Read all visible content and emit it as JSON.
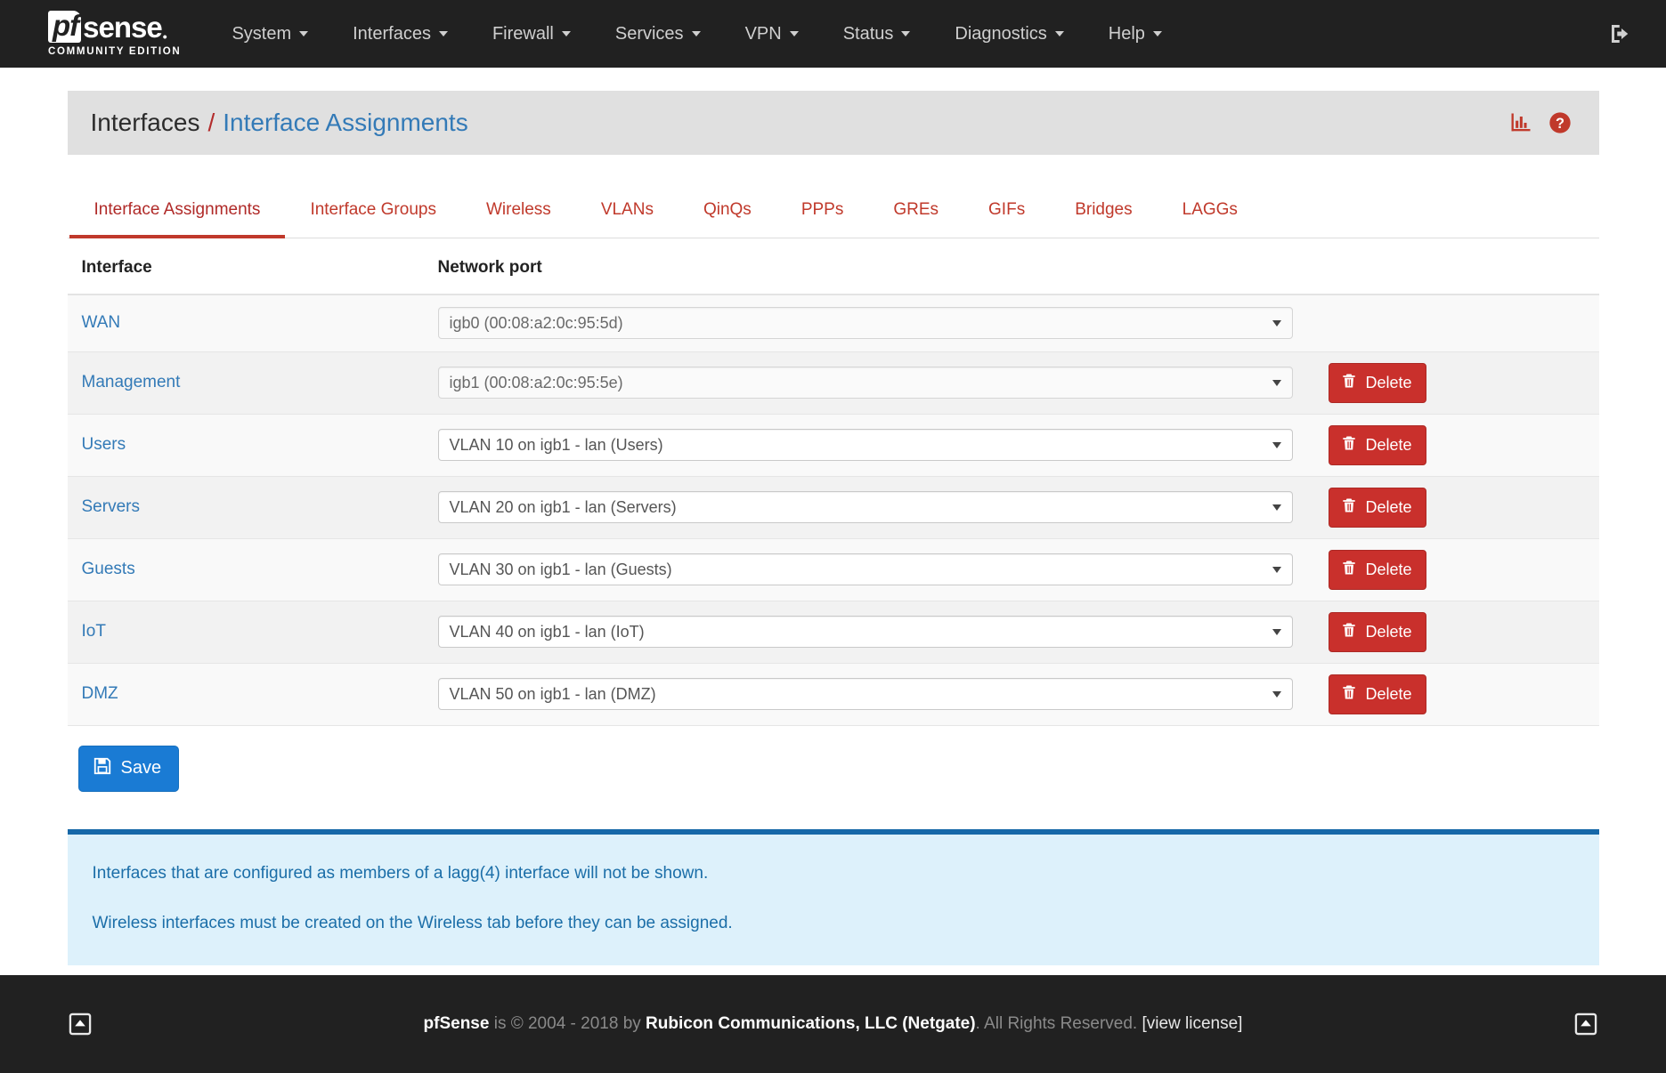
{
  "navbar": {
    "brand": {
      "pf": "pf",
      "sense": "sense",
      "edition": "COMMUNITY EDITION"
    },
    "items": [
      {
        "label": "System",
        "has_caret": true
      },
      {
        "label": "Interfaces",
        "has_caret": true
      },
      {
        "label": "Firewall",
        "has_caret": true
      },
      {
        "label": "Services",
        "has_caret": true
      },
      {
        "label": "VPN",
        "has_caret": true
      },
      {
        "label": "Status",
        "has_caret": true
      },
      {
        "label": "Diagnostics",
        "has_caret": true
      },
      {
        "label": "Help",
        "has_caret": true
      }
    ],
    "logout_icon": "logout-icon"
  },
  "header": {
    "breadcrumb_root": "Interfaces",
    "breadcrumb_sep": "/",
    "breadcrumb_current": "Interface Assignments",
    "icons": [
      {
        "name": "status-monitoring-icon"
      },
      {
        "name": "help-icon"
      }
    ]
  },
  "tabs": [
    {
      "label": "Interface Assignments",
      "active": true
    },
    {
      "label": "Interface Groups",
      "active": false
    },
    {
      "label": "Wireless",
      "active": false
    },
    {
      "label": "VLANs",
      "active": false
    },
    {
      "label": "QinQs",
      "active": false
    },
    {
      "label": "PPPs",
      "active": false
    },
    {
      "label": "GREs",
      "active": false
    },
    {
      "label": "GIFs",
      "active": false
    },
    {
      "label": "Bridges",
      "active": false
    },
    {
      "label": "LAGGs",
      "active": false
    }
  ],
  "table": {
    "headers": {
      "interface": "Interface",
      "network_port": "Network port"
    },
    "rows": [
      {
        "interface": "WAN",
        "port": "igb0 (00:08:a2:0c:95:5d)",
        "disabled": true,
        "delete": false
      },
      {
        "interface": "Management",
        "port": "igb1 (00:08:a2:0c:95:5e)",
        "disabled": true,
        "delete": true
      },
      {
        "interface": "Users",
        "port": "VLAN 10 on igb1 - lan (Users)",
        "disabled": false,
        "delete": true
      },
      {
        "interface": "Servers",
        "port": "VLAN 20 on igb1 - lan (Servers)",
        "disabled": false,
        "delete": true
      },
      {
        "interface": "Guests",
        "port": "VLAN 30 on igb1 - lan (Guests)",
        "disabled": false,
        "delete": true
      },
      {
        "interface": "IoT",
        "port": "VLAN 40 on igb1 - lan (IoT)",
        "disabled": false,
        "delete": true
      },
      {
        "interface": "DMZ",
        "port": "VLAN 50 on igb1 - lan (DMZ)",
        "disabled": false,
        "delete": true
      }
    ],
    "delete_label": "Delete"
  },
  "actions": {
    "save_label": "Save"
  },
  "info": {
    "line1": "Interfaces that are configured as members of a lagg(4) interface will not be shown.",
    "line2": "Wireless interfaces must be created on the Wireless tab before they can be assigned."
  },
  "footer": {
    "brand": "pfSense",
    "copy": " is © 2004 - 2018 by ",
    "company": "Rubicon Communications, LLC (Netgate)",
    "rights": ". All Rights Reserved. ",
    "license": "[view license]"
  },
  "colors": {
    "navbar_bg": "#212121",
    "accent_red": "#c0392b",
    "link_blue": "#337ab7",
    "save_blue": "#1a7bd4",
    "delete_red": "#c9302c",
    "info_bg": "#ddf1fb",
    "info_border": "#1668a8"
  }
}
